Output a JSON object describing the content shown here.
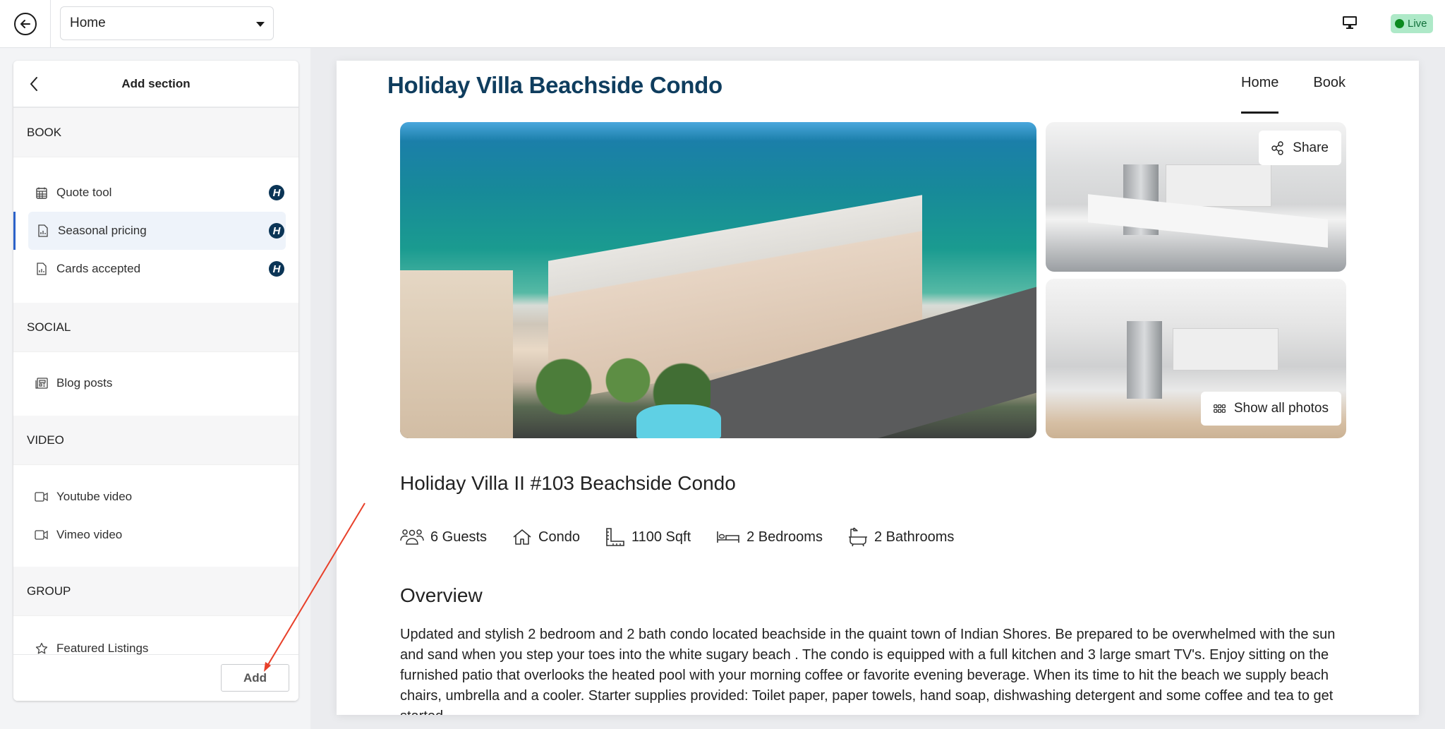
{
  "topbar": {
    "page_select_value": "Home",
    "live_label": "Live",
    "colors": {
      "live_bg": "#aee9c8",
      "live_dot": "#0b8a1f"
    }
  },
  "panel": {
    "title": "Add section",
    "groups": [
      {
        "heading": "BOOK",
        "items": [
          {
            "label": "Quote tool",
            "icon": "calendar-icon",
            "badge": "H",
            "selected": false
          },
          {
            "label": "Seasonal pricing",
            "icon": "document-chart-icon",
            "badge": "H",
            "selected": true
          },
          {
            "label": "Cards accepted",
            "icon": "document-chart-icon",
            "badge": "H",
            "selected": false
          }
        ]
      },
      {
        "heading": "SOCIAL",
        "items": [
          {
            "label": "Blog posts",
            "icon": "newspaper-icon"
          }
        ]
      },
      {
        "heading": "VIDEO",
        "items": [
          {
            "label": "Youtube video",
            "icon": "video-camera-icon"
          },
          {
            "label": "Vimeo video",
            "icon": "video-camera-icon"
          }
        ]
      },
      {
        "heading": "GROUP",
        "items": [
          {
            "label": "Featured Listings",
            "icon": "star-icon"
          }
        ]
      }
    ],
    "add_button": "Add"
  },
  "preview": {
    "site_title": "Holiday Villa Beachside Condo",
    "nav": [
      {
        "label": "Home",
        "active": true
      },
      {
        "label": "Book",
        "active": false
      }
    ],
    "share_label": "Share",
    "show_photos_label": "Show all photos",
    "property_title": "Holiday Villa II #103 Beachside Condo",
    "facts": [
      {
        "icon": "guests-icon",
        "label": "6 Guests"
      },
      {
        "icon": "house-icon",
        "label": "Condo"
      },
      {
        "icon": "ruler-icon",
        "label": "1100 Sqft"
      },
      {
        "icon": "bed-icon",
        "label": "2 Bedrooms"
      },
      {
        "icon": "bathtub-icon",
        "label": "2 Bathrooms"
      }
    ],
    "overview_heading": "Overview",
    "overview_text": "Updated and stylish 2 bedroom and 2 bath condo located beachside in the quaint town of Indian Shores. Be prepared to be overwhelmed with the sun and sand when you step your toes into the white sugary beach . The condo is equipped with a full kitchen and 3 large smart TV's. Enjoy sitting on the furnished patio that overlooks the heated pool with your morning coffee or favorite evening beverage. When its time to hit the beach we supply beach chairs, umbrella and a cooler. Starter supplies provided: Toilet paper, paper towels, hand soap, dishwashing detergent and some coffee and tea to get started.",
    "colors": {
      "title": "#0f3d5e"
    }
  }
}
